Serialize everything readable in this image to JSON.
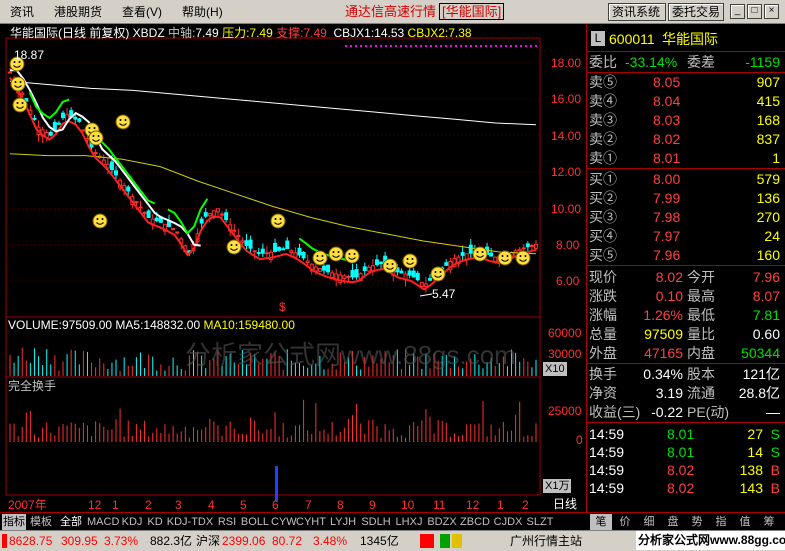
{
  "menu": [
    "资讯",
    "港股期货",
    "查看(V)",
    "帮助(H)"
  ],
  "title": {
    "main": "通达信高速行情",
    "sub": "[华能国际]"
  },
  "top_buttons": [
    "资讯系统",
    "委托交易"
  ],
  "window_controls": [
    "_",
    "□",
    "×"
  ],
  "chart_header": {
    "name": "华能国际(日线 前复权) XBDZ",
    "zhongzhou_label": "中轴:",
    "zhongzhou_value": "7.49",
    "yali_label": "压力:",
    "yali_value": "7.49",
    "zhicheng_label": "支撑:",
    "zhicheng_value": "7.49",
    "cbjx1": "CBJX1:14.53",
    "cbjx2": "CBJX2:7.38",
    "high_mark": "18.87",
    "low_mark": "5.47"
  },
  "price_axis": [
    "18.00",
    "16.00",
    "14.00",
    "12.00",
    "10.00",
    "8.00",
    "6.00"
  ],
  "volume_header": {
    "volume": "VOLUME:97509.00",
    "ma5": "MA5:148832.00",
    "ma10": "MA10:159480.00"
  },
  "volume_axis": [
    "60000",
    "30000"
  ],
  "volume_unit": "X10",
  "turnover_header": "完全换手",
  "turnover_axis": [
    "25000",
    "0"
  ],
  "turnover_unit": "X1万",
  "watermark": "分析家公式网www.88gs.com",
  "time_axis": [
    "2007年",
    "12",
    "1",
    "2",
    "3",
    "4",
    "5",
    "6",
    "7",
    "8",
    "9",
    "10",
    "11",
    "12",
    "1",
    "2"
  ],
  "period_label": "日线",
  "indicator_tabs": [
    "指标",
    "模板",
    "全部",
    "MACD",
    "KDJ",
    "KD",
    "KDJ-TDX",
    "RSI",
    "BOLL",
    "CYW",
    "CYHT",
    "LYJH",
    "SDLH",
    "LHXJ",
    "BDZX",
    "ZBCD",
    "CJDX",
    "SLZT"
  ],
  "right_tabs": [
    "笔",
    "价",
    "细",
    "盘",
    "势",
    "指",
    "值",
    "筹"
  ],
  "quote": {
    "code": "600011",
    "name": "华能国际",
    "weibi_label": "委比",
    "weibi": "-33.14%",
    "weicha_label": "委差",
    "weicha": "-1159",
    "asks": [
      {
        "label": "卖⑤",
        "price": "8.05",
        "vol": "907"
      },
      {
        "label": "卖④",
        "price": "8.04",
        "vol": "415"
      },
      {
        "label": "卖③",
        "price": "8.03",
        "vol": "168"
      },
      {
        "label": "卖②",
        "price": "8.02",
        "vol": "837"
      },
      {
        "label": "卖①",
        "price": "8.01",
        "vol": "1"
      }
    ],
    "bids": [
      {
        "label": "买①",
        "price": "8.00",
        "vol": "579"
      },
      {
        "label": "买②",
        "price": "7.99",
        "vol": "136"
      },
      {
        "label": "买③",
        "price": "7.98",
        "vol": "270"
      },
      {
        "label": "买④",
        "price": "7.97",
        "vol": "24"
      },
      {
        "label": "买⑤",
        "price": "7.96",
        "vol": "160"
      }
    ],
    "stats": [
      {
        "l1": "现价",
        "v1": "8.02",
        "l2": "今开",
        "v2": "7.96",
        "c1": "#ff4040",
        "c2": "#ff4040"
      },
      {
        "l1": "涨跌",
        "v1": "0.10",
        "l2": "最高",
        "v2": "8.07",
        "c1": "#ff4040",
        "c2": "#ff4040"
      },
      {
        "l1": "涨幅",
        "v1": "1.26%",
        "l2": "最低",
        "v2": "7.81",
        "c1": "#ff4040",
        "c2": "#00e000"
      },
      {
        "l1": "总量",
        "v1": "97509",
        "l2": "量比",
        "v2": "0.60",
        "c1": "#ffff00",
        "c2": "#ffffff"
      },
      {
        "l1": "外盘",
        "v1": "47165",
        "l2": "内盘",
        "v2": "50344",
        "c1": "#ff4040",
        "c2": "#00e000"
      }
    ],
    "stats2": [
      {
        "l1": "换手",
        "v1": "0.34%",
        "l2": "股本",
        "v2": "121亿"
      },
      {
        "l1": "净资",
        "v1": "3.19",
        "l2": "流通",
        "v2": "28.8亿"
      },
      {
        "l1": "收益(三)",
        "v1": "-0.22",
        "l2": "PE(动)",
        "v2": "—"
      }
    ],
    "ticks": [
      {
        "time": "14:59",
        "price": "8.01",
        "vol": "27",
        "side": "S",
        "color": "#00e000"
      },
      {
        "time": "14:59",
        "price": "8.01",
        "vol": "14",
        "side": "S",
        "color": "#00e000"
      },
      {
        "time": "14:59",
        "price": "8.02",
        "vol": "138",
        "side": "B",
        "color": "#ff4040"
      },
      {
        "time": "14:59",
        "price": "8.02",
        "vol": "143",
        "side": "B",
        "color": "#ff4040"
      }
    ]
  },
  "statusbar": {
    "idx1": "8628.75",
    "idx1_chg": "309.95",
    "idx1_pct": "3.73%",
    "idx1_amt": "882.3亿",
    "idx2_label": "沪深",
    "idx2": "2399.06",
    "idx2_chg": "80.72",
    "idx2_pct": "3.48%",
    "idx2_amt": "1345亿",
    "server": "广州行情主站",
    "site": "分析家公式网www.88gg.com"
  },
  "colors": {
    "up": "#ff3030",
    "down": "#00ffff",
    "ma_white": "#ffffff",
    "ma_yellow": "#d0d000",
    "ma_green": "#00ff00",
    "grid": "#a00000"
  },
  "chart_data": {
    "type": "candlestick",
    "ylim": [
      5.0,
      19.0
    ],
    "price_ma_slow": [
      17.0,
      16.8,
      16.6,
      16.5,
      16.3,
      16.1,
      15.9,
      15.7,
      15.5,
      15.3,
      15.1,
      14.9,
      14.7,
      14.6
    ],
    "ma_yellow": [
      13.0,
      12.9,
      12.9,
      12.7,
      12.3,
      11.5,
      10.8,
      10.1,
      9.5,
      9.0,
      8.6,
      8.2,
      7.9,
      7.6,
      7.5
    ],
    "close_series": [
      17.5,
      16.2,
      14.5,
      14.0,
      15.2,
      14.8,
      13.2,
      12.5,
      11.5,
      10.5,
      9.5,
      9.2,
      8.8,
      7.5,
      9.5,
      10.0,
      9.0,
      8.0,
      7.5,
      7.6,
      7.8,
      7.4,
      6.8,
      6.5,
      6.3,
      6.2,
      6.8,
      7.0,
      6.5,
      6.3,
      5.8,
      6.5,
      7.2,
      7.5,
      7.6,
      7.3,
      7.5,
      7.8,
      8.02
    ]
  }
}
